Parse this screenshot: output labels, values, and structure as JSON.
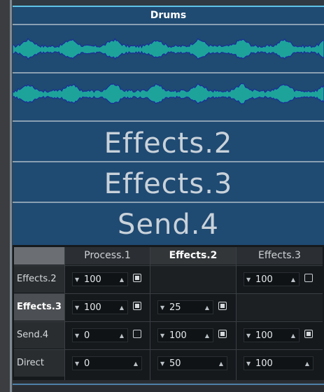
{
  "track": {
    "title": "Drums"
  },
  "lanes": [
    "Effects.2",
    "Effects.3",
    "Send.4"
  ],
  "matrix": {
    "columns": [
      {
        "label": "Process.1",
        "active": false
      },
      {
        "label": "Effects.2",
        "active": true
      },
      {
        "label": "Effects.3",
        "active": false
      }
    ],
    "rows": [
      {
        "label": "Effects.2",
        "cells": [
          {
            "value": "100",
            "checked": true
          },
          null,
          {
            "value": "100",
            "checked": false
          }
        ]
      },
      {
        "label": "Effects.3",
        "cells": [
          {
            "value": "100",
            "checked": true
          },
          {
            "value": "25",
            "checked": true
          },
          null
        ]
      },
      {
        "label": "Send.4",
        "cells": [
          {
            "value": "0",
            "checked": false
          },
          {
            "value": "100",
            "checked": true
          },
          {
            "value": "100",
            "checked": true
          }
        ]
      },
      {
        "label": "Direct",
        "cells": [
          {
            "value": "0"
          },
          {
            "value": "50"
          },
          {
            "value": "100"
          }
        ]
      }
    ]
  },
  "icons": {
    "spin_down": "triangle-down-icon",
    "spin_up": "triangle-up-icon"
  },
  "colors": {
    "track_bg": "#1f4a72",
    "wave_fill": "#1ea39b",
    "wave_outline": "#1a2e9a",
    "accent": "#5fc2e6"
  }
}
